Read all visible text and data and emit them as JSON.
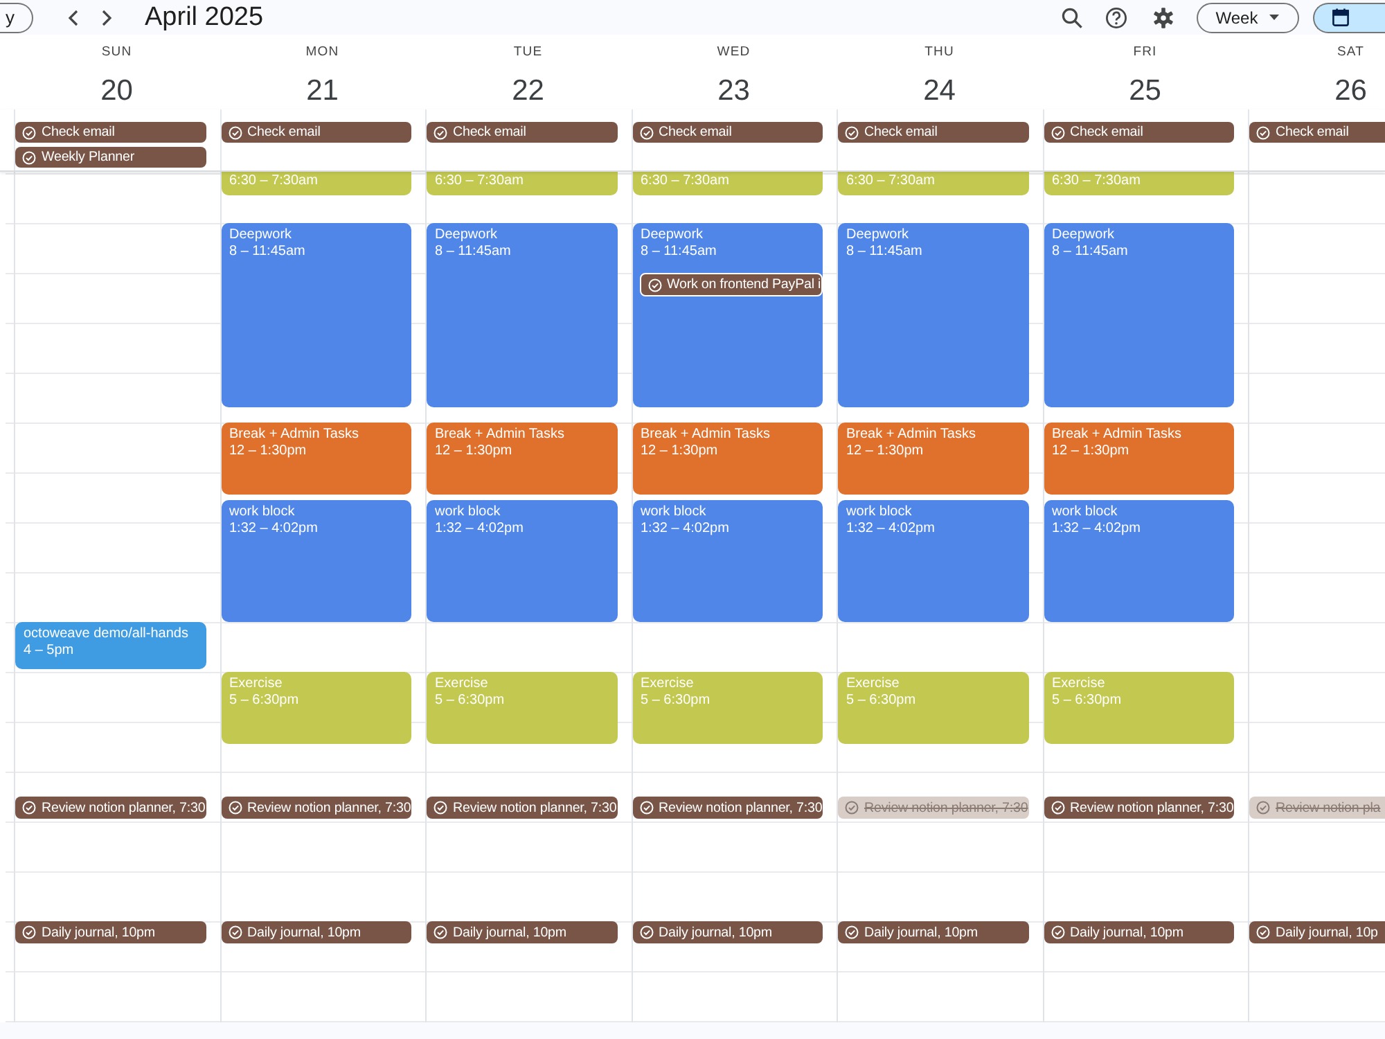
{
  "toolbar": {
    "today_button": "y",
    "month_title": "April 2025",
    "view_button": "Week",
    "view_toggle": [
      {
        "selected": true
      }
    ]
  },
  "days": [
    {
      "weekday": "SUN",
      "date": "20",
      "all_day": [
        {
          "title": "Check email",
          "done": false
        },
        {
          "title": "Weekly Planner",
          "done": false
        }
      ],
      "events": [
        {
          "title": "octoweave demo/all-hands",
          "time": "4 – 5pm",
          "color": "#3f9be2"
        }
      ]
    },
    {
      "weekday": "MON",
      "date": "21",
      "all_day": [
        {
          "title": "Check email",
          "done": false
        }
      ],
      "events": [
        {
          "time": "6:30 – 7:30am",
          "color": "#c3c850"
        },
        {
          "title": "Deepwork",
          "time": "8 – 11:45am",
          "color": "#4f86e8"
        },
        {
          "title": "Break + Admin Tasks",
          "time": "12 – 1:30pm",
          "color": "#e0712c"
        },
        {
          "title": "work block",
          "time": "1:32 – 4:02pm",
          "color": "#4f86e8"
        },
        {
          "title": "Exercise",
          "time": "5 – 6:30pm",
          "color": "#c3c850"
        }
      ]
    },
    {
      "weekday": "TUE",
      "date": "22",
      "all_day": [
        {
          "title": "Check email",
          "done": false
        }
      ],
      "events": [
        {
          "time": "6:30 – 7:30am",
          "color": "#c3c850"
        },
        {
          "title": "Deepwork",
          "time": "8 – 11:45am",
          "color": "#4f86e8"
        },
        {
          "title": "Break + Admin Tasks",
          "time": "12 – 1:30pm",
          "color": "#e0712c"
        },
        {
          "title": "work block",
          "time": "1:32 – 4:02pm",
          "color": "#4f86e8"
        },
        {
          "title": "Exercise",
          "time": "5 – 6:30pm",
          "color": "#c3c850"
        }
      ]
    },
    {
      "weekday": "WED",
      "date": "23",
      "all_day": [
        {
          "title": "Check email",
          "done": false
        }
      ],
      "events": [
        {
          "time": "6:30 – 7:30am",
          "color": "#c3c850"
        },
        {
          "title": "Deepwork",
          "time": "8 – 11:45am",
          "color": "#4f86e8",
          "tasks": [
            {
              "title": "Work on frontend PayPal i",
              "done": false
            }
          ]
        },
        {
          "title": "Break + Admin Tasks",
          "time": "12 – 1:30pm",
          "color": "#e0712c"
        },
        {
          "title": "work block",
          "time": "1:32 – 4:02pm",
          "color": "#4f86e8"
        },
        {
          "title": "Exercise",
          "time": "5 – 6:30pm",
          "color": "#c3c850"
        }
      ]
    },
    {
      "weekday": "THU",
      "date": "24",
      "all_day": [
        {
          "title": "Check email",
          "done": false
        }
      ],
      "events": [
        {
          "time": "6:30 – 7:30am",
          "color": "#c3c850"
        },
        {
          "title": "Deepwork",
          "time": "8 – 11:45am",
          "color": "#4f86e8"
        },
        {
          "title": "Break + Admin Tasks",
          "time": "12 – 1:30pm",
          "color": "#e0712c"
        },
        {
          "title": "work block",
          "time": "1:32 – 4:02pm",
          "color": "#4f86e8"
        },
        {
          "title": "Exercise",
          "time": "5 – 6:30pm",
          "color": "#c3c850"
        }
      ]
    },
    {
      "weekday": "FRI",
      "date": "25",
      "all_day": [
        {
          "title": "Check email",
          "done": false
        }
      ],
      "events": [
        {
          "time": "6:30 – 7:30am",
          "color": "#c3c850"
        },
        {
          "title": "Deepwork",
          "time": "8 – 11:45am",
          "color": "#4f86e8"
        },
        {
          "title": "Break + Admin Tasks",
          "time": "12 – 1:30pm",
          "color": "#e0712c"
        },
        {
          "title": "work block",
          "time": "1:32 – 4:02pm",
          "color": "#4f86e8"
        },
        {
          "title": "Exercise",
          "time": "5 – 6:30pm",
          "color": "#c3c850"
        }
      ]
    },
    {
      "weekday": "SAT",
      "date": "26",
      "all_day": [
        {
          "title": "Check email",
          "done": false
        }
      ]
    }
  ],
  "task_rows": [
    {
      "tasks": [
        {
          "title": "Review notion planner, 7:30",
          "done": false
        },
        {
          "title": "Review notion planner, 7:30",
          "done": false
        },
        {
          "title": "Review notion planner, 7:30",
          "done": false
        },
        {
          "title": "Review notion planner, 7:30",
          "done": false
        },
        {
          "title": "Review notion planner, 7:30",
          "done": true
        },
        {
          "title": "Review notion planner, 7:30",
          "done": false
        },
        {
          "title": "Review notion pla",
          "done": true
        }
      ]
    },
    {
      "tasks": [
        {
          "title": "Daily journal, 10pm",
          "done": false
        },
        {
          "title": "Daily journal, 10pm",
          "done": false
        },
        {
          "title": "Daily journal, 10pm",
          "done": false
        },
        {
          "title": "Daily journal, 10pm",
          "done": false
        },
        {
          "title": "Daily journal, 10pm",
          "done": false
        },
        {
          "title": "Daily journal, 10pm",
          "done": false
        },
        {
          "title": "Daily journal, 10p",
          "done": false
        }
      ]
    }
  ]
}
